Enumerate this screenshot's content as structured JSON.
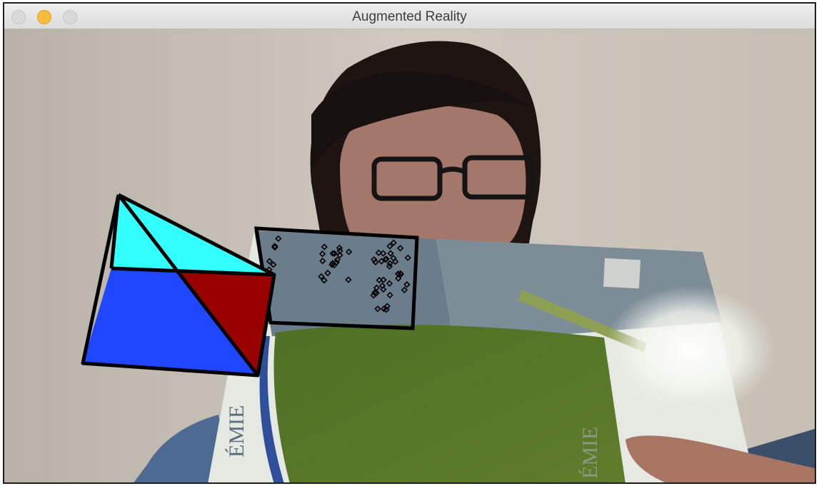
{
  "window": {
    "title": "Augmented Reality",
    "buttons": [
      "close",
      "minimize",
      "zoom"
    ]
  },
  "scene": {
    "book_cover_text_left": "ÉMIE",
    "book_cover_text_right": "ÉMIE",
    "pyramid_colors": {
      "top_face": "#33ffff",
      "front_face": "#1f47ff",
      "right_face": "#990000",
      "outline": "#000000"
    },
    "tracking_box_color": "#000000"
  }
}
